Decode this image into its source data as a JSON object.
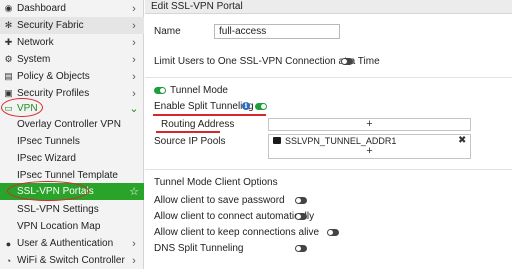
{
  "sidebar": {
    "items": [
      {
        "label": "Dashboard",
        "icon": "dashboard-icon",
        "glyph": "◉",
        "chev": "›"
      },
      {
        "label": "Security Fabric",
        "icon": "security-fabric-icon",
        "glyph": "✻",
        "chev": "›"
      },
      {
        "label": "Network",
        "icon": "network-icon",
        "glyph": "✚",
        "chev": "›"
      },
      {
        "label": "System",
        "icon": "gear-icon",
        "glyph": "⚙",
        "chev": "›"
      },
      {
        "label": "Policy & Objects",
        "icon": "policy-icon",
        "glyph": "▤",
        "chev": "›"
      },
      {
        "label": "Security Profiles",
        "icon": "lock-icon",
        "glyph": "▣",
        "chev": "›"
      },
      {
        "label": "VPN",
        "icon": "monitor-icon",
        "glyph": "▭",
        "chev": "⌄"
      },
      {
        "label": "User & Authentication",
        "icon": "user-icon",
        "glyph": "●",
        "chev": "›"
      },
      {
        "label": "WiFi & Switch Controller",
        "icon": "wifi-icon",
        "glyph": "◔",
        "chev": "›"
      }
    ],
    "vpn_sub": [
      "Overlay Controller VPN",
      "IPsec Tunnels",
      "IPsec Wizard",
      "IPsec Tunnel Template",
      "SSL-VPN Portals",
      "SSL-VPN Settings",
      "VPN Location Map"
    ],
    "favorite_star": "☆"
  },
  "main": {
    "title": "Edit SSL-VPN Portal",
    "name_label": "Name",
    "name_value": "full-access",
    "limit_label": "Limit Users to One SSL-VPN Connection at a Time",
    "tunnel_mode_label": "Tunnel Mode",
    "split_tunneling_label": "Enable Split Tunneling",
    "info_glyph": "i",
    "routing_address_label": "Routing Address",
    "source_ip_pools_label": "Source IP Pools",
    "source_ip_pool_value": "SSLVPN_TUNNEL_ADDR1",
    "plus_glyph": "+",
    "remove_glyph": "✖",
    "client_options_title": "Tunnel Mode Client Options",
    "client_options": [
      "Allow client to save password",
      "Allow client to connect automatically",
      "Allow client to keep connections alive",
      "DNS Split Tunneling"
    ]
  },
  "colors": {
    "accent_green": "#29a329",
    "toggle_on": "#1e9e3c",
    "annotation_red": "#d8262e",
    "info_blue": "#2a6cbf"
  }
}
